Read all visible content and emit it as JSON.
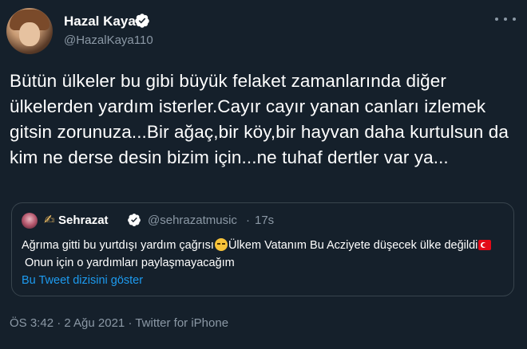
{
  "author": {
    "name": "Hazal Kaya",
    "handle": "@HazalKaya110",
    "verified_icon": "verified-badge-icon"
  },
  "tweet": {
    "text": "Bütün ülkeler bu gibi büyük felaket zamanlarında diğer ülkelerden yardım isterler.Cayır cayır yanan canları izlemek gitsin zorunuza...Bir ağaç,bir köy,bir hayvan daha kurtulsun da kim ne derse desin bizim için...ne tuhaf dertler var ya...",
    "meta": "ÖS 3:42 · 2 Ağu 2021 · Twitter for iPhone"
  },
  "quote": {
    "name": "Sehrazat",
    "handle": "@sehrazatmusic",
    "separator": "·",
    "time": "17s",
    "text_part1": "Ağrıma gitti bu yurtdışı yardım çağrısı",
    "text_part2": "Ülkem Vatanım Bu Acziyete düşecek ülke değildi",
    "text_part3": "Onun için o yardımları paylaşmayacağım",
    "thread_link": "Bu Tweet dizisini göster"
  },
  "colors": {
    "background": "#15202b",
    "text": "#ffffff",
    "secondary": "#8b98a5",
    "link": "#1d9bf0",
    "border": "#38444d",
    "verified": "#1d9bf0"
  }
}
